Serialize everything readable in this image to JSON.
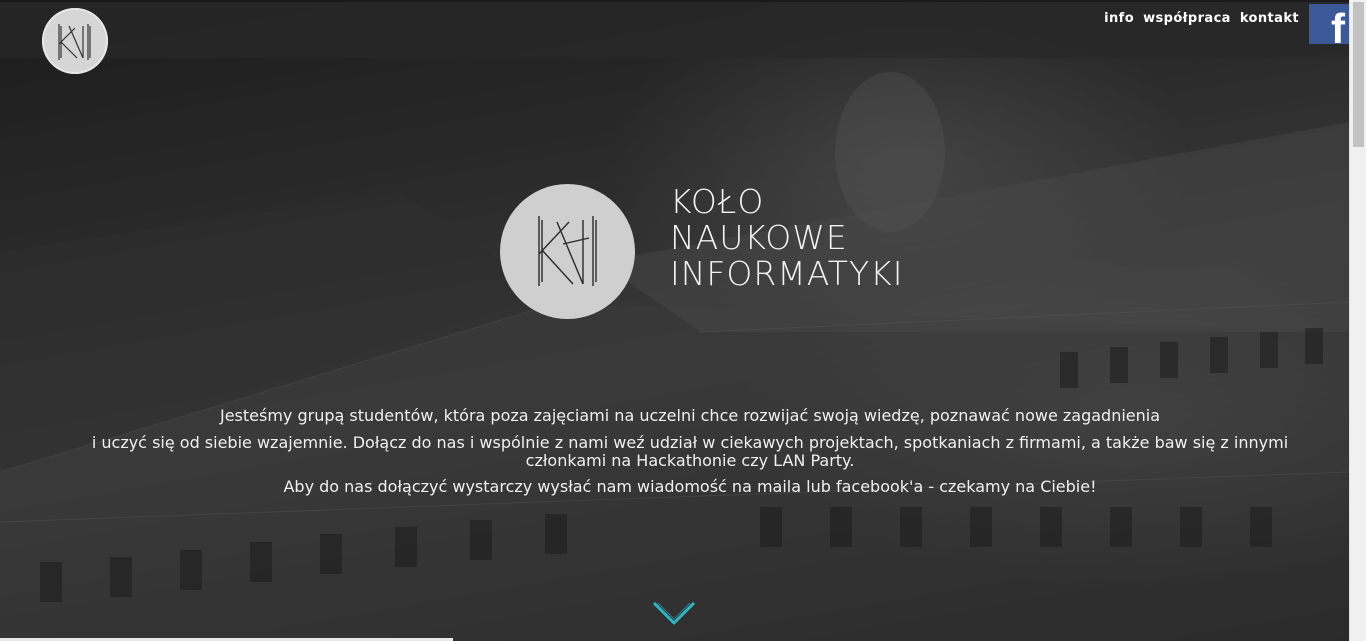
{
  "nav": {
    "info_label": "info",
    "cooperation_label": "współpraca",
    "contact_label": "kontakt",
    "facebook_icon": "facebook-icon",
    "facebook_glyph": "f"
  },
  "brand": {
    "monogram_icon": "kni-monogram-icon"
  },
  "hero": {
    "title_line1": "KOŁO",
    "title_line2": "NAUKOWE",
    "title_line3": "INFORMATYKI",
    "paragraph1": "Jesteśmy grupą studentów, która poza zajęciami na uczelni chce rozwijać swoją wiedzę, poznawać nowe zagadnienia",
    "paragraph2": "i uczyć się od siebie wzajemnie. Dołącz do nas i wspólnie z nami weź udział w ciekawych projektach, spotkaniach z firmami, a także baw się z innymi członkami na Hackathonie czy LAN Party.",
    "paragraph3": "Aby do nas dołączyć wystarczy wysłać nam wiadomość na maila lub facebook'a - czekamy na Ciebie!",
    "scroll_icon": "chevron-down-icon"
  },
  "colors": {
    "accent": "#2fb6c1",
    "facebook": "#3b5998",
    "text": "#f0f0f0"
  }
}
